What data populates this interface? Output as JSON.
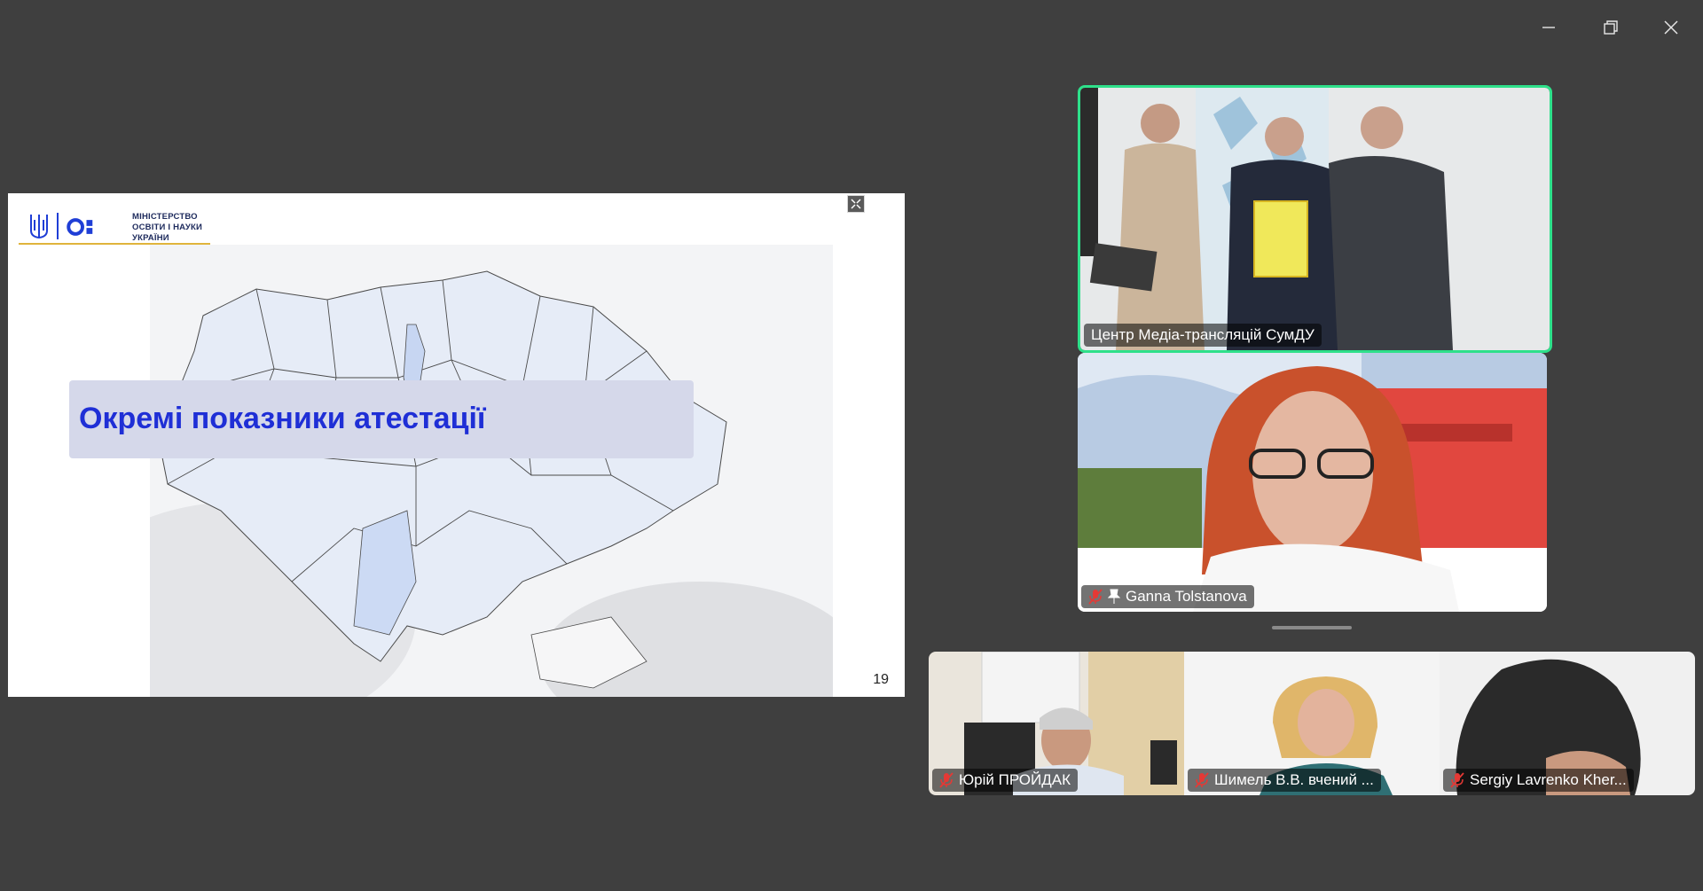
{
  "window_controls": {
    "minimize_icon": "minimize-icon",
    "restore_icon": "restore-icon",
    "close_icon": "close-icon"
  },
  "shared_slide": {
    "org_name": "МІНІСТЕРСТВО\nОСВІТИ І НАУКИ\nУКРАЇНИ",
    "title": "Окремі показники атестації",
    "page_number": "19",
    "colors": {
      "accent": "#1f2fd6",
      "title_bg": "#d5d8ea",
      "rule": "#e0b43c"
    }
  },
  "participants": {
    "featured": {
      "name": "Центр Медіа-трансляцій СумДУ",
      "speaking": true,
      "speaking_color": "#2ee08a"
    },
    "second": {
      "name": "Ganna Tolstanova",
      "muted": true,
      "pinned": true
    },
    "gallery": [
      {
        "name": "Юрій ПРОЙДАК",
        "muted": true
      },
      {
        "name": "Шимель В.В. вчений ...",
        "muted": true
      },
      {
        "name": "Sergiy Lavrenko Kher...",
        "muted": true
      }
    ]
  }
}
